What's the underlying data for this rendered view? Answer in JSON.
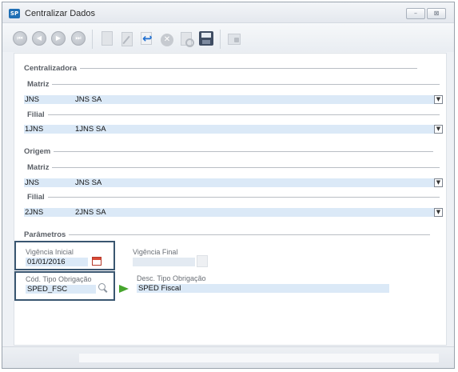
{
  "window": {
    "title": "Centralizar Dados",
    "app_icon_text": "SP",
    "minimize_glyph": "–",
    "close_glyph": "⊠"
  },
  "toolbar": {
    "first": "⏮",
    "prev": "◀",
    "next": "▶",
    "last": "⏭",
    "cancel": "✕"
  },
  "centralizadora": {
    "title": "Centralizadora",
    "matriz": {
      "label": "Matriz",
      "code": "JNS",
      "name": "JNS SA"
    },
    "filial": {
      "label": "Filial",
      "code": "1JNS",
      "name": "1JNS SA"
    }
  },
  "origem": {
    "title": "Origem",
    "matriz": {
      "label": "Matriz",
      "code": "JNS",
      "name": "JNS SA"
    },
    "filial": {
      "label": "Filial",
      "code": "2JNS",
      "name": "2JNS SA"
    }
  },
  "parametros": {
    "title": "Parâmetros",
    "vigencia_inicial": {
      "label": "Vigência Inicial",
      "value": "01/01/2016"
    },
    "vigencia_final": {
      "label": "Vigência Final",
      "value": ""
    },
    "cod_tipo_obrigacao": {
      "label": "Cód. Tipo Obrigação",
      "value": "SPED_FSC"
    },
    "desc_tipo_obrigacao": {
      "label": "Desc. Tipo Obrigação",
      "value": "SPED Fiscal"
    }
  },
  "combo_arrow_glyph": "▼"
}
